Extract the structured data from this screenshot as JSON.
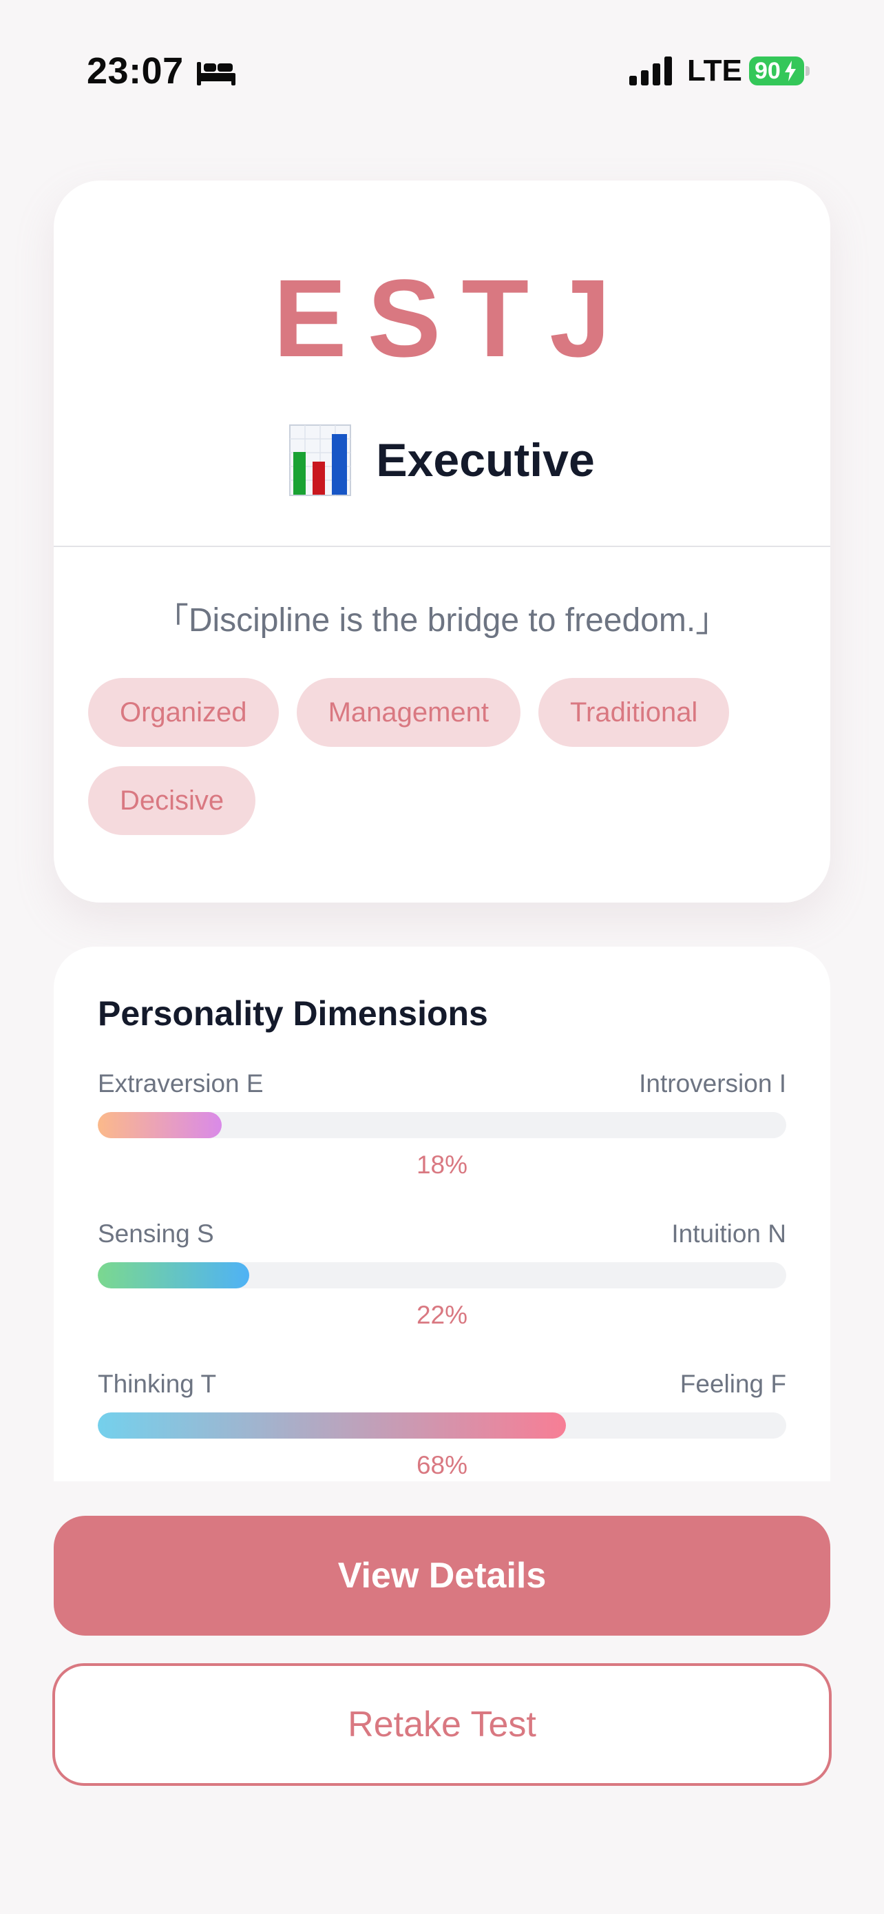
{
  "status_bar": {
    "time": "23:07",
    "focus_icon": "bed-icon",
    "network": "LTE",
    "battery": "90"
  },
  "result": {
    "type_code": "ESTJ",
    "type_icon": "bar-chart-icon",
    "type_name": "Executive",
    "quote": "「Discipline is the bridge to freedom.」",
    "tags": [
      "Organized",
      "Management",
      "Traditional",
      "Decisive"
    ]
  },
  "dimensions": {
    "title": "Personality Dimensions",
    "items": [
      {
        "left": "Extraversion E",
        "right": "Introversion I",
        "percent_label": "18%",
        "value": 0.18,
        "gradient": [
          "#fbb98a",
          "#d98ae8"
        ]
      },
      {
        "left": "Sensing S",
        "right": "Intuition N",
        "percent_label": "22%",
        "value": 0.22,
        "gradient": [
          "#7bd88f",
          "#4fb2f5"
        ]
      },
      {
        "left": "Thinking T",
        "right": "Feeling F",
        "percent_label": "68%",
        "value": 0.68,
        "gradient": [
          "#74d0ec",
          "#f77e95"
        ]
      }
    ]
  },
  "actions": {
    "primary_label": "View Details",
    "secondary_label": "Retake Test"
  },
  "colors": {
    "accent": "#d97881",
    "tag_background": "#f5dadd",
    "battery": "#34c759"
  }
}
